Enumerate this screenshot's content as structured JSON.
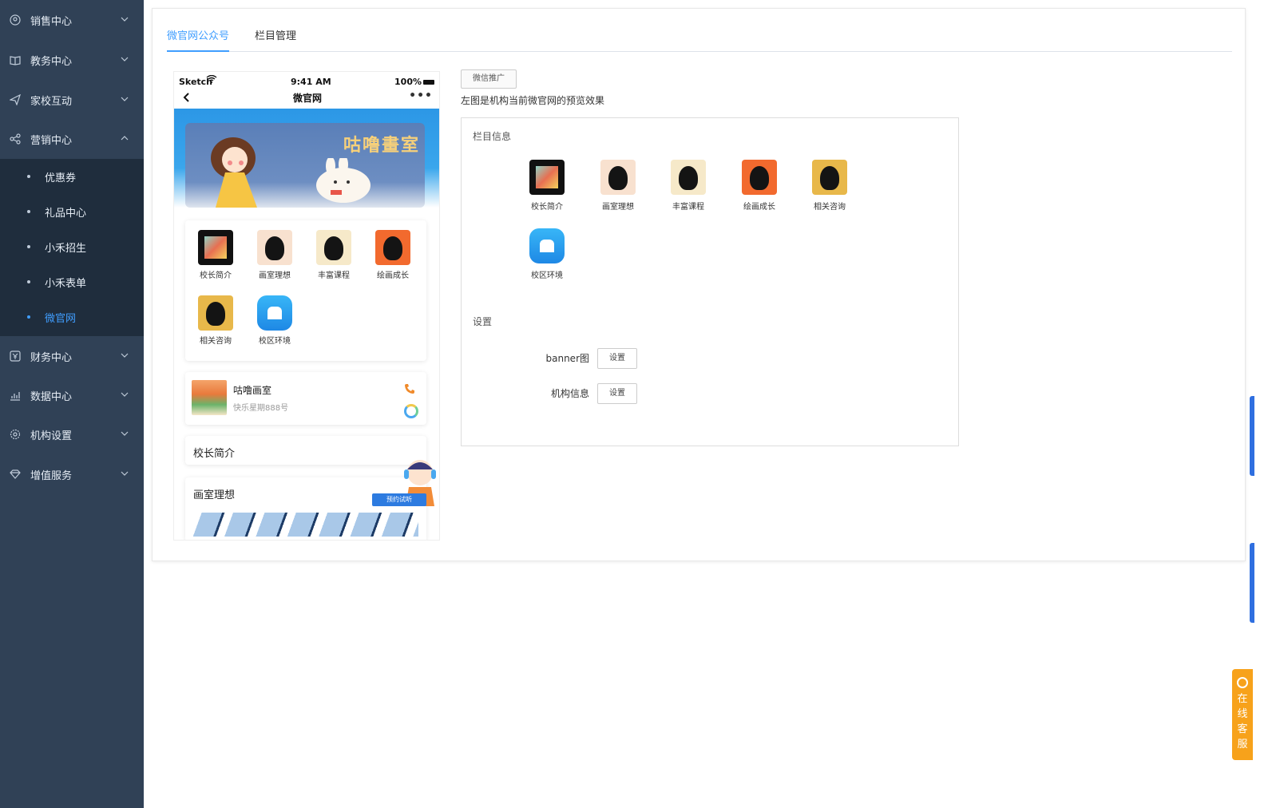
{
  "sidebar": {
    "items": [
      {
        "label": "销售中心",
        "icon": "user-circle-icon"
      },
      {
        "label": "教务中心",
        "icon": "book-icon"
      },
      {
        "label": "家校互动",
        "icon": "paper-plane-icon"
      },
      {
        "label": "营销中心",
        "icon": "share-icon"
      },
      {
        "label": "财务中心",
        "icon": "yen-icon"
      },
      {
        "label": "数据中心",
        "icon": "chart-icon"
      },
      {
        "label": "机构设置",
        "icon": "gear-icon"
      },
      {
        "label": "增值服务",
        "icon": "diamond-icon"
      }
    ],
    "submenu": [
      {
        "label": "优惠券"
      },
      {
        "label": "礼品中心"
      },
      {
        "label": "小禾招生"
      },
      {
        "label": "小禾表单"
      },
      {
        "label": "微官网"
      }
    ],
    "active_color": "#409eff"
  },
  "tabs": [
    {
      "label": "微官网公众号"
    },
    {
      "label": "栏目管理"
    }
  ],
  "phone": {
    "carrier": "Sketch",
    "time": "9:41 AM",
    "battery": "100%",
    "nav_title": "微官网",
    "more": "•••",
    "banner_text": "咕噜畫室",
    "grid": [
      {
        "label": "校长简介"
      },
      {
        "label": "画室理想"
      },
      {
        "label": "丰富课程"
      },
      {
        "label": "绘画成长"
      },
      {
        "label": "相关咨询"
      },
      {
        "label": "校区环境"
      }
    ],
    "org": {
      "name": "咕噜画室",
      "address": "快乐星期888号"
    },
    "sections": [
      {
        "title": "校长简介"
      },
      {
        "title": "画室理想"
      }
    ],
    "trial_button": "预约试听"
  },
  "right": {
    "promo_button": "微信推广",
    "preview_desc": "左图是机构当前微官网的预览效果",
    "column_info_title": "栏目信息",
    "columns": [
      {
        "label": "校长简介"
      },
      {
        "label": "画室理想"
      },
      {
        "label": "丰富课程"
      },
      {
        "label": "绘画成长"
      },
      {
        "label": "相关咨询"
      },
      {
        "label": "校区环境"
      }
    ],
    "settings_title": "设置",
    "settings": [
      {
        "label": "banner图",
        "button": "设置"
      },
      {
        "label": "机构信息",
        "button": "设置"
      }
    ]
  },
  "customer_service": {
    "label_chars": [
      "在",
      "线",
      "客",
      "服"
    ]
  }
}
